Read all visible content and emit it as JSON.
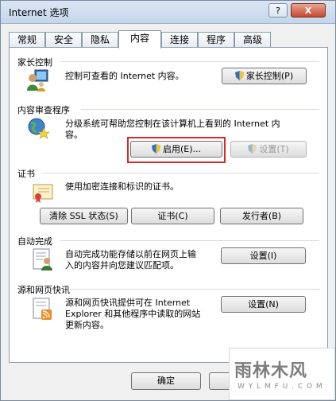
{
  "window": {
    "title": "Internet 选项",
    "help_label": "?",
    "close_label": "X"
  },
  "tabs": [
    "常规",
    "安全",
    "隐私",
    "内容",
    "连接",
    "程序",
    "高级"
  ],
  "active_tab": "内容",
  "sections": {
    "parental": {
      "title": "家长控制",
      "description": "控制可查看的 Internet 内容。",
      "button": "家长控制(P)"
    },
    "advisor": {
      "title": "内容审查程序",
      "description_line1": "分级系统可帮助您控制在该计算机上看到的 Internet 内",
      "description_line2": "容。",
      "enable_button": "启用(E)...",
      "settings_button": "设置(T)"
    },
    "certificates": {
      "title": "证书",
      "description": "使用加密连接和标识的证书。",
      "clear_ssl_button": "清除 SSL 状态(S)",
      "certificates_button": "证书(C)",
      "publishers_button": "发行者(B)"
    },
    "autocomplete": {
      "title": "自动完成",
      "description_line1": "自动完成功能存储以前在网页上输",
      "description_line2": "入的内容并向您建议匹配项。",
      "settings_button": "设置(I)"
    },
    "feeds": {
      "title": "源和网页快讯",
      "description_line1": "源和网页快讯提供可在 Internet",
      "description_line2": "Explorer 和其他程序中读取的网站",
      "description_line3": "更新内容。",
      "settings_button": "设置(N)"
    }
  },
  "footer": {
    "ok_button": "确定",
    "cancel_button": "取消"
  },
  "watermark": {
    "text": "雨林木风",
    "url": "W Y L M F U . C O M"
  },
  "colors": {
    "highlight": "#d62b2b",
    "shield_blue": "#2f6fc6",
    "shield_yellow": "#f2c230"
  }
}
